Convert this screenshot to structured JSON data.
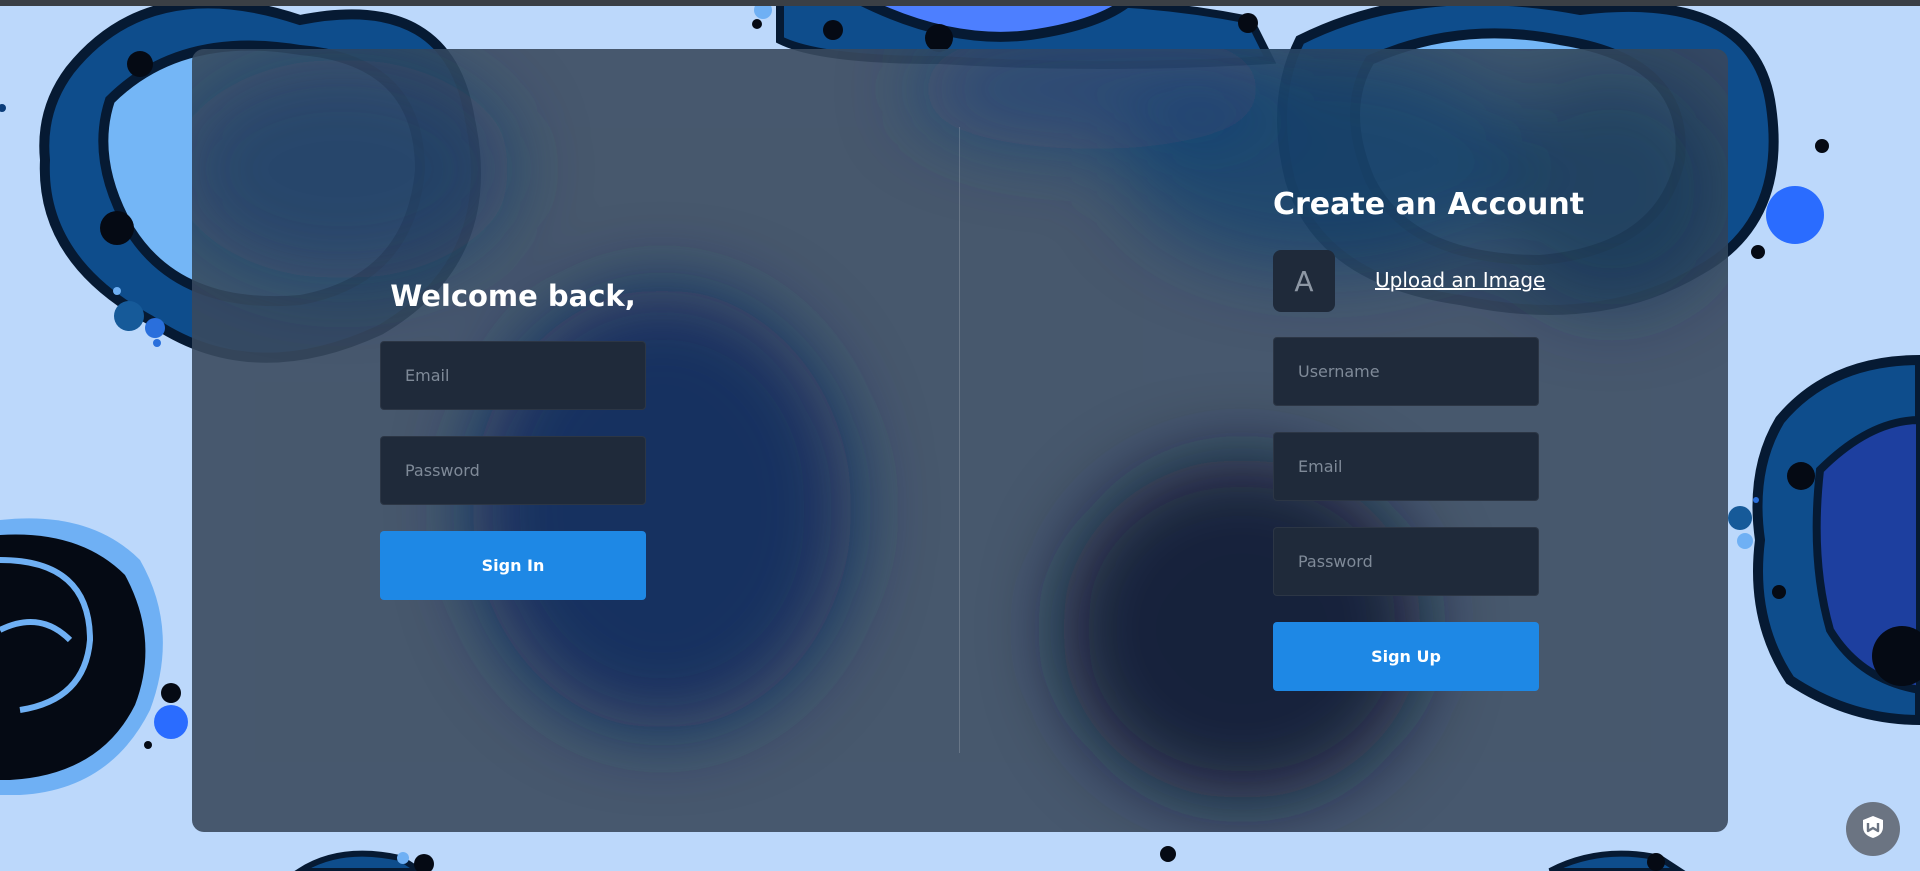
{
  "login": {
    "heading": "Welcome back,",
    "email_placeholder": "Email",
    "password_placeholder": "Password",
    "submit_label": "Sign In"
  },
  "signup": {
    "heading": "Create an Account",
    "avatar_letter": "A",
    "upload_label": "Upload an Image",
    "username_placeholder": "Username",
    "email_placeholder": "Email",
    "password_placeholder": "Password",
    "submit_label": "Sign Up"
  },
  "theme": {
    "accent": "#1e88e5",
    "page_background": "#bcd8fb",
    "card_background": "#3a4a5e",
    "field_background": "#1f2a3a"
  },
  "icons": {
    "corner_badge": "shield-icon"
  }
}
